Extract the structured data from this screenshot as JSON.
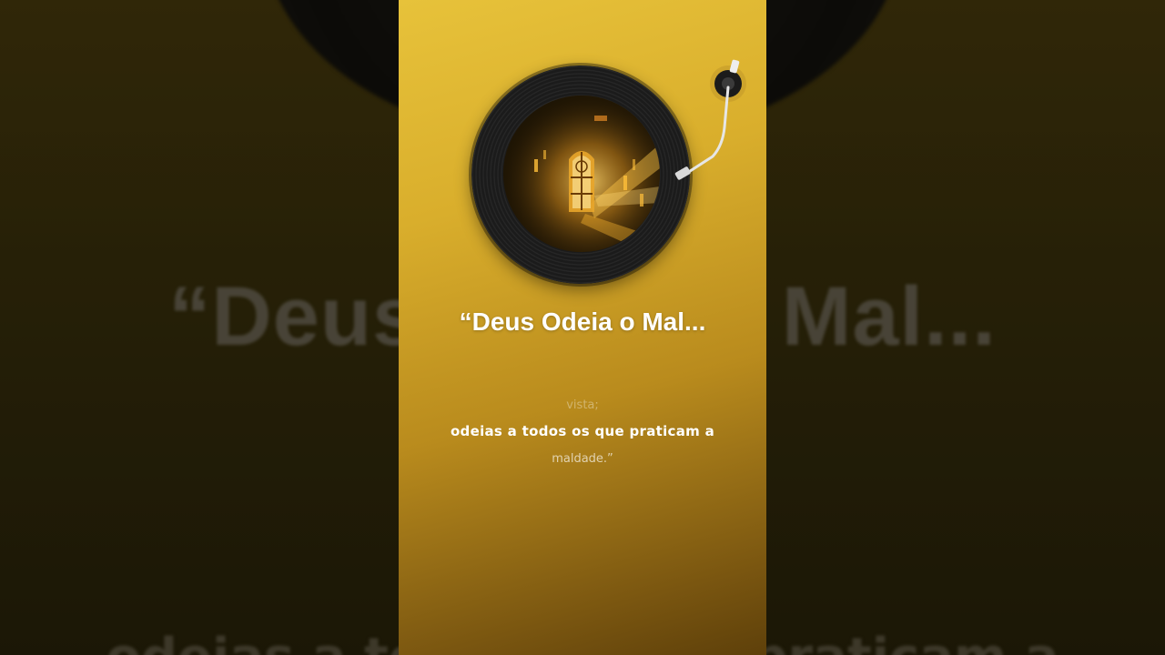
{
  "video": {
    "title": "“Deus Odeia o Mal...",
    "background_title": "“Deus Odeia o Mal...",
    "background_lyric": "odeias a todos os que praticam a"
  },
  "lyrics": {
    "previous": "vista;",
    "current": "odeias a todos os que praticam a",
    "next": "maldade.”"
  },
  "colors": {
    "panel_top": "#e7c23a",
    "panel_bottom": "#5e400a",
    "text": "#ffffff"
  },
  "icons": {
    "record": "vinyl-record-icon",
    "tonearm": "tonearm-icon"
  }
}
